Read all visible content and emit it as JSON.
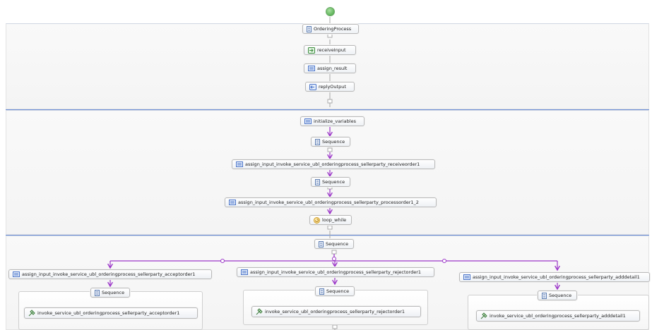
{
  "colors": {
    "flow": "#9b35c8",
    "separator": "#6c8fd8",
    "connector": "#a9a9a9",
    "start": "#5fb35a"
  },
  "diagram": {
    "ordering_process": "OrderingProcess",
    "receive_input": "receiveInput",
    "assign_result": "assign_result",
    "reply_output": "replyOutput",
    "initialize_variables": "initialize_variables",
    "sequence_1": "Sequence",
    "assign_receiveorder": "assign_input_invoke_service_ubl_orderingprocess_sellerparty_receiveorder1",
    "sequence_2": "Sequence",
    "assign_processorder": "assign_input_invoke_service_ubl_orderingprocess_sellerparty_processorder1_2",
    "loop_while": "loop_while",
    "sequence_3": "Sequence",
    "branches": [
      {
        "assign": "assign_input_invoke_service_ubl_orderingprocess_sellerparty_acceptorder1",
        "sequence": "Sequence",
        "invoke": "invoke_service_ubl_orderingprocess_sellerparty_acceptorder1"
      },
      {
        "assign": "assign_input_invoke_service_ubl_orderingprocess_sellerparty_rejectorder1",
        "sequence": "Sequence",
        "invoke": "invoke_service_ubl_orderingprocess_sellerparty_rejectorder1"
      },
      {
        "assign": "assign_input_invoke_service_ubl_orderingprocess_sellerparty_adddetail1",
        "sequence": "Sequence",
        "invoke": "invoke_service_ubl_orderingprocess_sellerparty_adddetail1"
      }
    ]
  },
  "icons": {
    "sequence": "sequence-icon",
    "receive": "receive-icon",
    "assign": "assign-icon",
    "reply": "reply-icon",
    "loop": "loop-icon",
    "invoke": "invoke-icon",
    "start": "start-event-icon"
  }
}
